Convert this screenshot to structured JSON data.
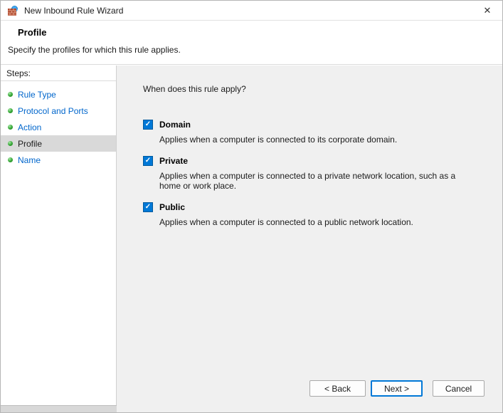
{
  "window": {
    "title": "New Inbound Rule Wizard"
  },
  "header": {
    "title": "Profile",
    "subtitle": "Specify the profiles for which this rule applies."
  },
  "sidebar": {
    "heading": "Steps:",
    "items": [
      {
        "label": "Rule Type",
        "active": false
      },
      {
        "label": "Protocol and Ports",
        "active": false
      },
      {
        "label": "Action",
        "active": false
      },
      {
        "label": "Profile",
        "active": true
      },
      {
        "label": "Name",
        "active": false
      }
    ]
  },
  "main": {
    "question": "When does this rule apply?",
    "profiles": [
      {
        "label": "Domain",
        "checked": true,
        "description": "Applies when a computer is connected to its corporate domain."
      },
      {
        "label": "Private",
        "checked": true,
        "description": "Applies when a computer is connected to a private network location, such as a home or work place."
      },
      {
        "label": "Public",
        "checked": true,
        "description": "Applies when a computer is connected to a public network location."
      }
    ]
  },
  "footer": {
    "back_label": "< Back",
    "next_label": "Next >",
    "cancel_label": "Cancel"
  },
  "icons": {
    "close": "✕",
    "check": "✓"
  },
  "colors": {
    "accent": "#0078d7",
    "link_blue": "#0066cc",
    "bullet_green": "#34a534",
    "content_bg": "#f0f0f0",
    "active_step_bg": "#d9d9d9"
  }
}
